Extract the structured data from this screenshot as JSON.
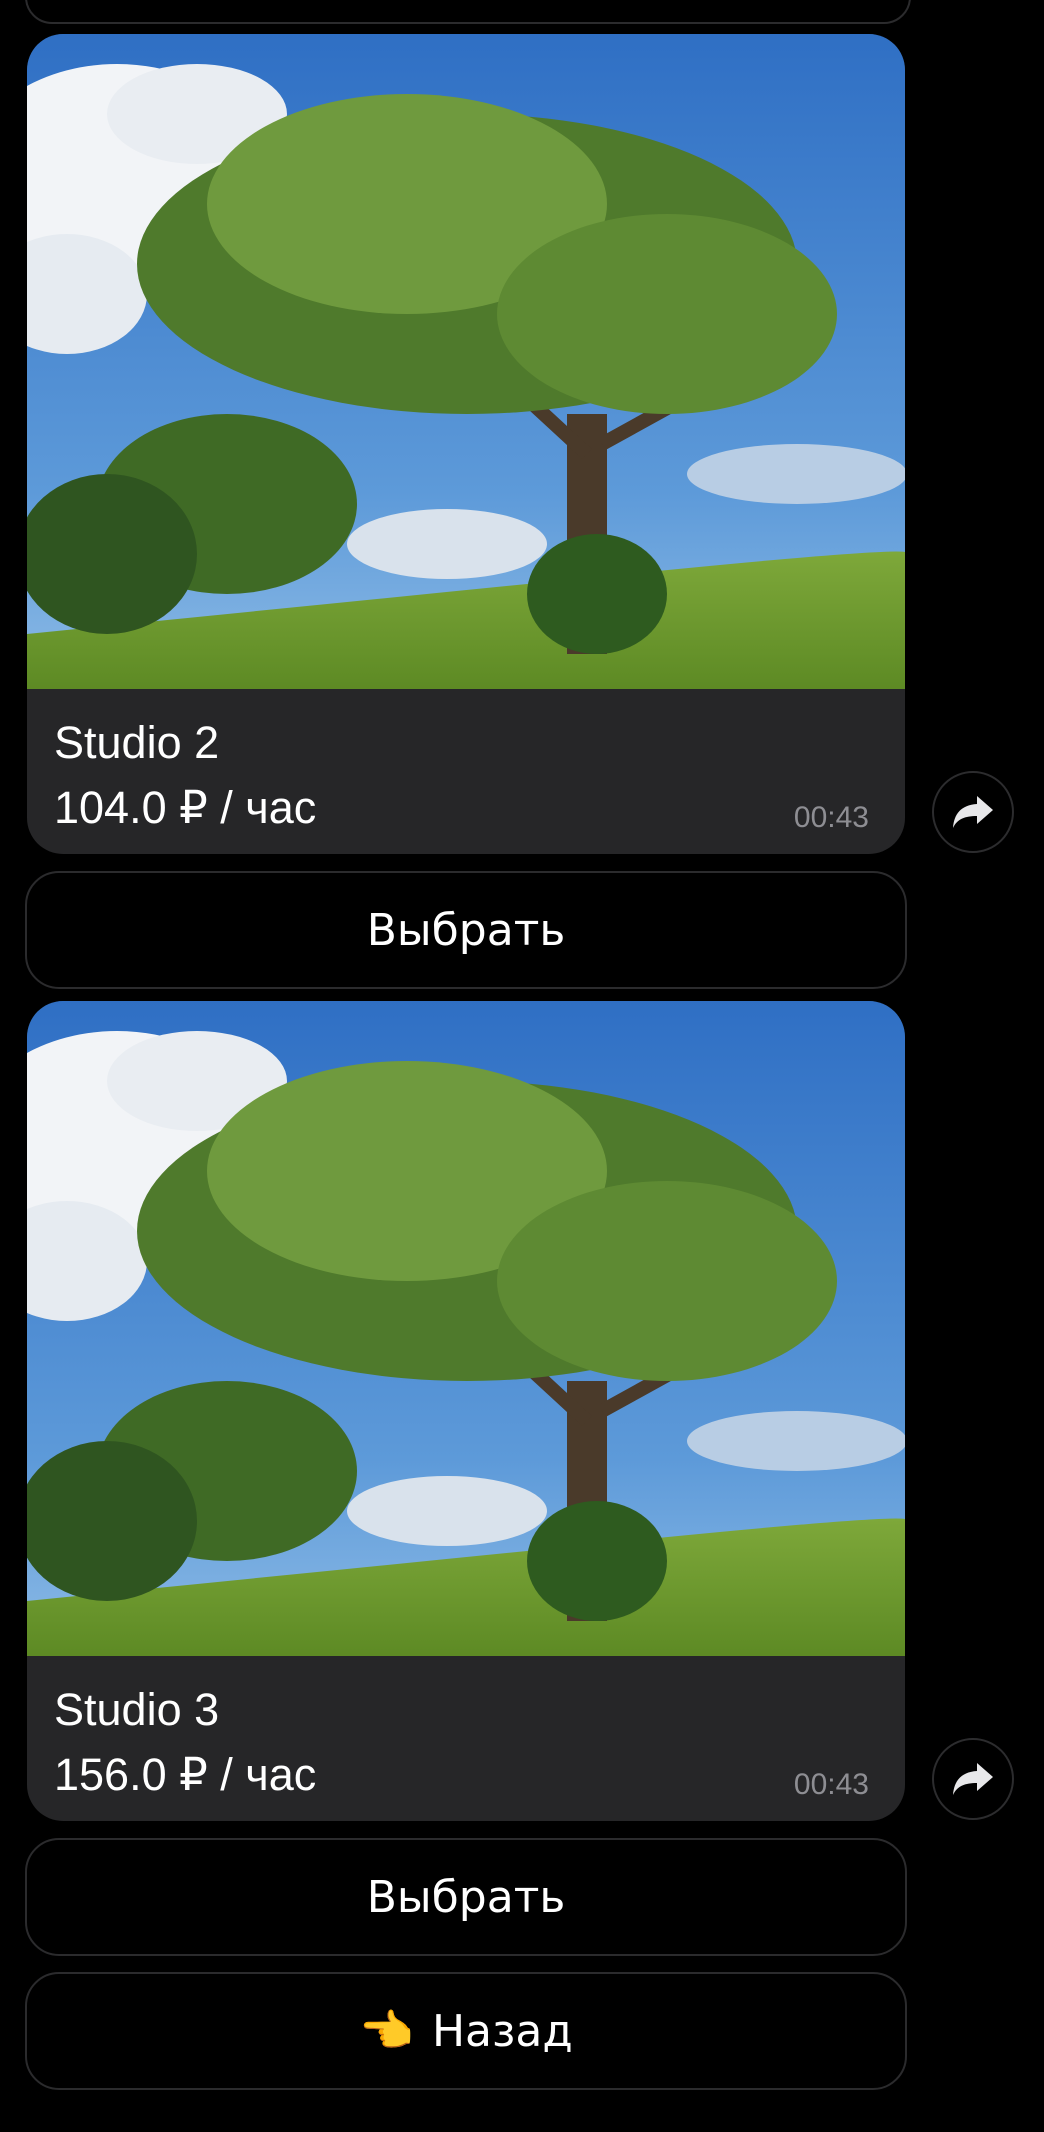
{
  "messages": [
    {
      "title": "Studio 2",
      "price": "104.0 ₽ / час",
      "time": "00:43",
      "button_label": "Выбрать"
    },
    {
      "title": "Studio 3",
      "price": "156.0 ₽ / час",
      "time": "00:43",
      "button_label": "Выбрать"
    }
  ],
  "back_button": {
    "emoji": "👈",
    "label": "Назад"
  },
  "colors": {
    "background": "#000000",
    "bubble": "#262628",
    "button_border": "#2b2b2d",
    "time_text": "#8e8e93"
  },
  "icons": {
    "share": "share-arrow-icon"
  }
}
